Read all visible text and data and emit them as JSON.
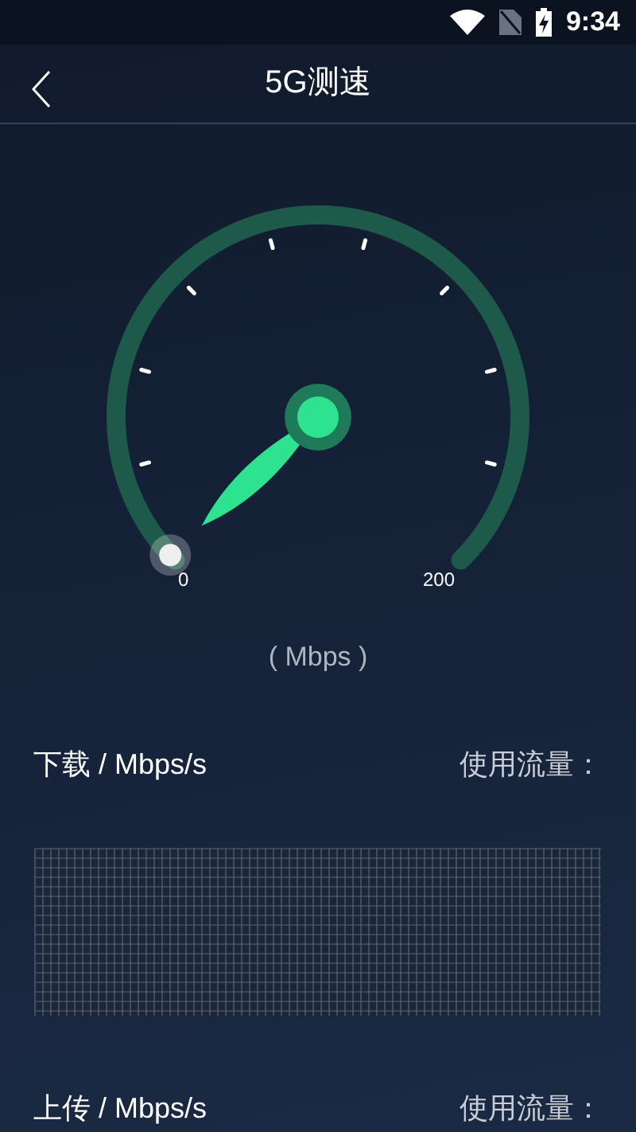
{
  "status_bar": {
    "time": "9:34"
  },
  "header": {
    "title": "5G测速"
  },
  "gauge": {
    "min_label": "0",
    "max_label": "200",
    "unit": "( Mbps )"
  },
  "sections": [
    {
      "title": "下载 / Mbps/s",
      "usage_label": "使用流量：",
      "kind": "chart"
    },
    {
      "title": "上传 / Mbps/s",
      "usage_label": "使用流量：",
      "kind": "header"
    }
  ]
}
